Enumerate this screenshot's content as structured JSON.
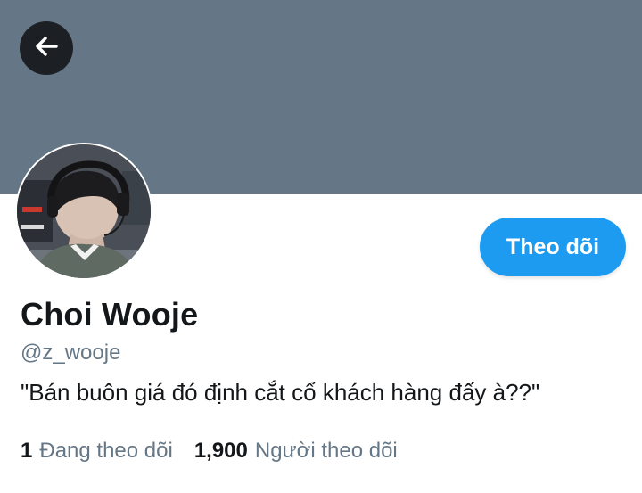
{
  "profile": {
    "display_name": "Choi Wooje",
    "handle": "@z_wooje",
    "bio": "\"Bán buôn giá đó định cắt cổ khách hàng đấy à??\"",
    "follow_button_label": "Theo dõi",
    "stats": {
      "following_count": "1",
      "following_label": "Đang theo dõi",
      "followers_count": "1,900",
      "followers_label": "Người theo dõi"
    }
  },
  "icons": {
    "back": "arrow-left-icon"
  },
  "colors": {
    "banner": "#657786",
    "accent": "#1d9bf0",
    "text_primary": "#14171a",
    "text_secondary": "#657786"
  }
}
